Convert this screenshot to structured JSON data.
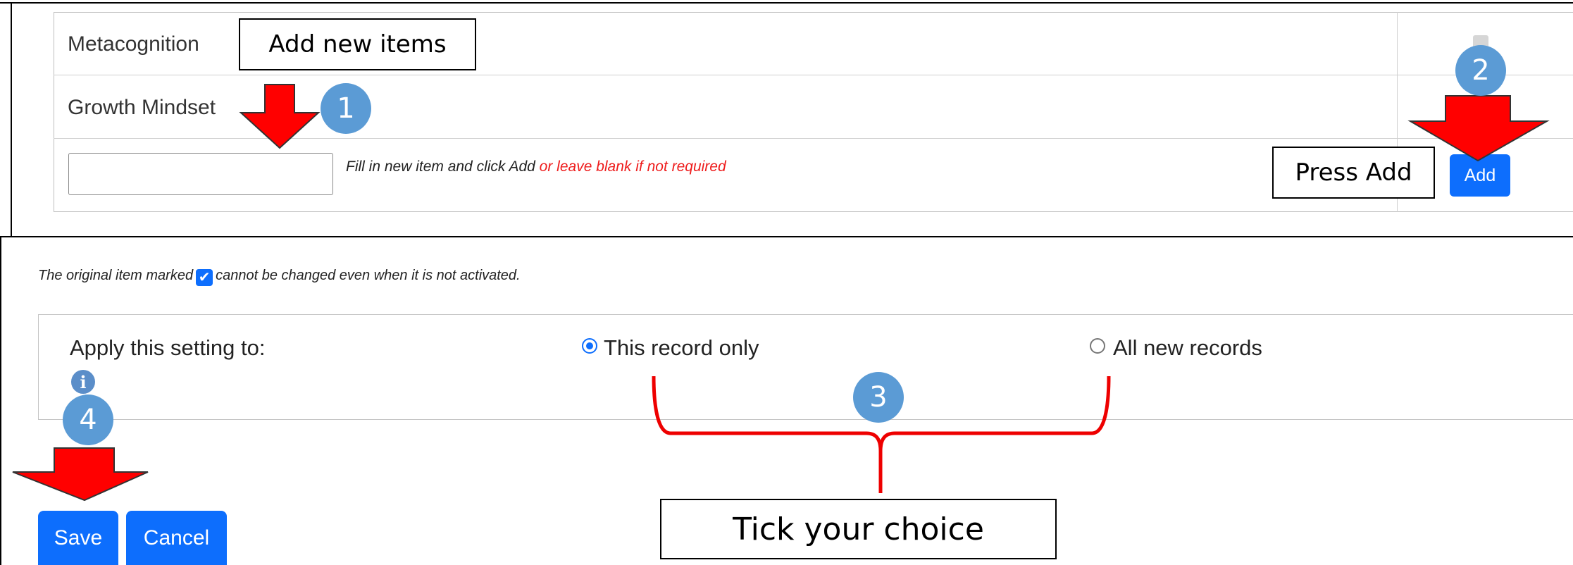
{
  "items_table": {
    "rows": [
      "Metacognition",
      "Growth Mindset"
    ],
    "new_item_input": {
      "value": "",
      "placeholder": ""
    },
    "hint_black": "Fill in new item and click Add",
    "hint_red": "or leave blank if not required",
    "add_label": "Add"
  },
  "note": {
    "before": "The original item marked",
    "after": "cannot be changed even when it is not activated."
  },
  "apply": {
    "label": "Apply this setting to:",
    "options": [
      {
        "label": "This record only",
        "checked": true
      },
      {
        "label": "All new records",
        "checked": false
      }
    ]
  },
  "footer": {
    "save_label": "Save",
    "cancel_label": "Cancel"
  },
  "annotations": {
    "add_new_items": "Add new items",
    "press_add": "Press Add",
    "tick_choice": "Tick your choice",
    "steps": [
      "1",
      "2",
      "3",
      "4"
    ]
  },
  "colors": {
    "primary": "#0d6efd",
    "arrow": "#ff0000",
    "step_badge": "#5b9bd5",
    "hint_red": "#ee1c1c"
  },
  "icons": {
    "info": "info-icon",
    "checked_box": "checkbox-checked-icon",
    "disabled_box": "checkbox-disabled-icon"
  }
}
